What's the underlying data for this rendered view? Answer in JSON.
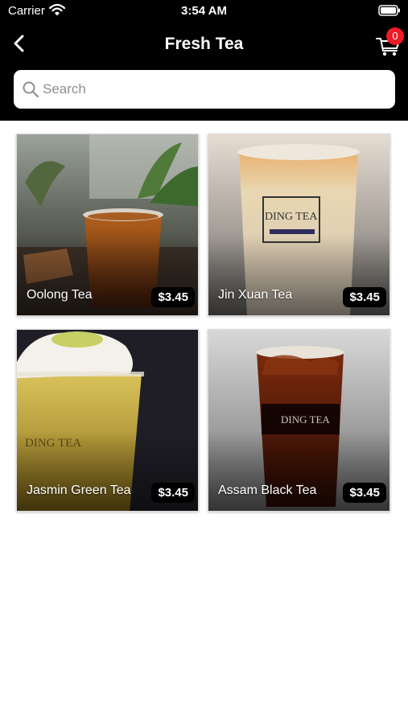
{
  "status_bar": {
    "carrier": "Carrier",
    "time": "3:54 AM"
  },
  "header": {
    "title": "Fresh Tea",
    "cart_count": "0"
  },
  "search": {
    "placeholder": "Search"
  },
  "products": [
    {
      "name": "Oolong Tea",
      "price": "$3.45"
    },
    {
      "name": "Jin Xuan Tea",
      "price": "$3.45"
    },
    {
      "name": "Jasmin Green Tea",
      "price": "$3.45"
    },
    {
      "name": "Assam Black Tea",
      "price": "$3.45"
    }
  ],
  "colors": {
    "bar": "#000000",
    "badge": "#ee1c25",
    "background": "#ffffff"
  },
  "icons": [
    "wifi-icon",
    "battery-icon",
    "back-chevron-icon",
    "cart-icon",
    "search-icon"
  ]
}
